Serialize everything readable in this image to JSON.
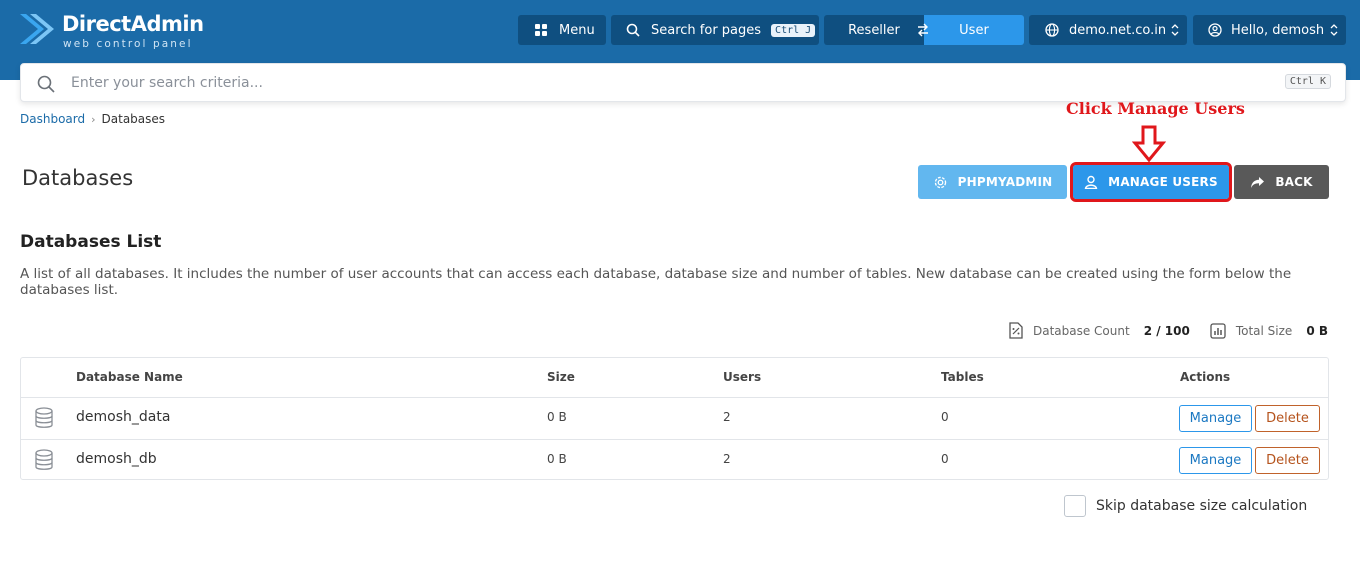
{
  "header": {
    "logo_title": "DirectAdmin",
    "logo_subtitle": "web control panel",
    "menu_label": "Menu",
    "search_pages_label": "Search for pages",
    "search_pages_shortcut": "Ctrl J",
    "role_reseller": "Reseller",
    "role_user": "User",
    "domain": "demo.net.co.in",
    "greeting": "Hello, demosh"
  },
  "search": {
    "placeholder": "Enter your search criteria...",
    "shortcut": "Ctrl K"
  },
  "breadcrumb": {
    "home": "Dashboard",
    "current": "Databases"
  },
  "annotation": {
    "text": "Click Manage Users",
    "color": "#e0171b"
  },
  "page": {
    "title": "Databases",
    "buttons": {
      "phpmyadmin": "PHPMYADMIN",
      "manage_users": "MANAGE USERS",
      "back": "BACK"
    }
  },
  "section": {
    "title": "Databases List",
    "description": "A list of all databases. It includes the number of user accounts that can access each database, database size and number of tables. New database can be created using the form below the databases list."
  },
  "stats": {
    "count_label": "Database Count",
    "count_value": "2 / 100",
    "size_label": "Total Size",
    "size_value": "0 B"
  },
  "table": {
    "headers": {
      "name": "Database Name",
      "size": "Size",
      "users": "Users",
      "tables": "Tables",
      "actions": "Actions"
    },
    "rows": [
      {
        "name": "demosh_data",
        "size": "0 B",
        "users": "2",
        "tables": "0",
        "manage": "Manage",
        "delete": "Delete"
      },
      {
        "name": "demosh_db",
        "size": "0 B",
        "users": "2",
        "tables": "0",
        "manage": "Manage",
        "delete": "Delete"
      }
    ]
  },
  "options": {
    "skip_size_label": "Skip database size calculation"
  },
  "colors": {
    "header_bg": "#1b6ba8",
    "header_button_bg": "#0f4f80",
    "accent": "#2c97ea",
    "phpmyadmin_bg": "#62b7ef",
    "back_bg": "#595959",
    "delete_accent": "#b5531c"
  },
  "icons": [
    "logo-icon",
    "grid-icon",
    "search-icon",
    "swap-icon",
    "globe-icon",
    "user-icon",
    "chevron-updown-icon",
    "gear-icon",
    "share-icon",
    "database-count-icon",
    "chart-icon",
    "database-icon",
    "down-arrow-icon"
  ]
}
